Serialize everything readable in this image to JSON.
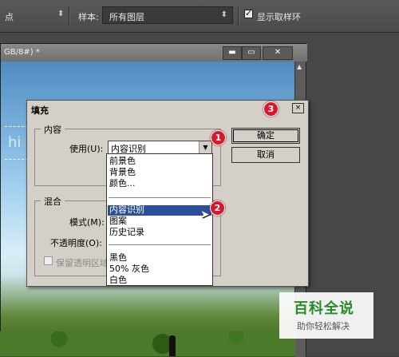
{
  "options_bar": {
    "left_label": "点",
    "sample_label": "样本:",
    "sample_value": "所有图层",
    "show_ring_label": "显示取样环"
  },
  "document": {
    "title": "GB/8#) *",
    "btn_min": "▬",
    "btn_restore": "▭",
    "btn_close": "✕",
    "bg_text": "hi"
  },
  "dialog": {
    "title": "填充",
    "close_label": "×",
    "content_group": "内容",
    "use_label": "使用(U):",
    "use_value": "内容识别",
    "blend_group": "混合",
    "mode_label": "模式(M):",
    "opacity_label": "不透明度(O):",
    "preserve_label": "保留透明区域",
    "ok_label": "确定",
    "cancel_label": "取消"
  },
  "dropdown": {
    "group1": [
      "前景色",
      "背景色",
      "颜色..."
    ],
    "group2": [
      "内容识别",
      "图案",
      "历史记录"
    ],
    "group3": [
      "黑色",
      "50% 灰色",
      "白色"
    ],
    "selected": "内容识别"
  },
  "markers": {
    "one": "1",
    "two": "2",
    "three": "3"
  },
  "watermark": {
    "title": "百科全说",
    "subtitle": "助你轻松解决"
  }
}
